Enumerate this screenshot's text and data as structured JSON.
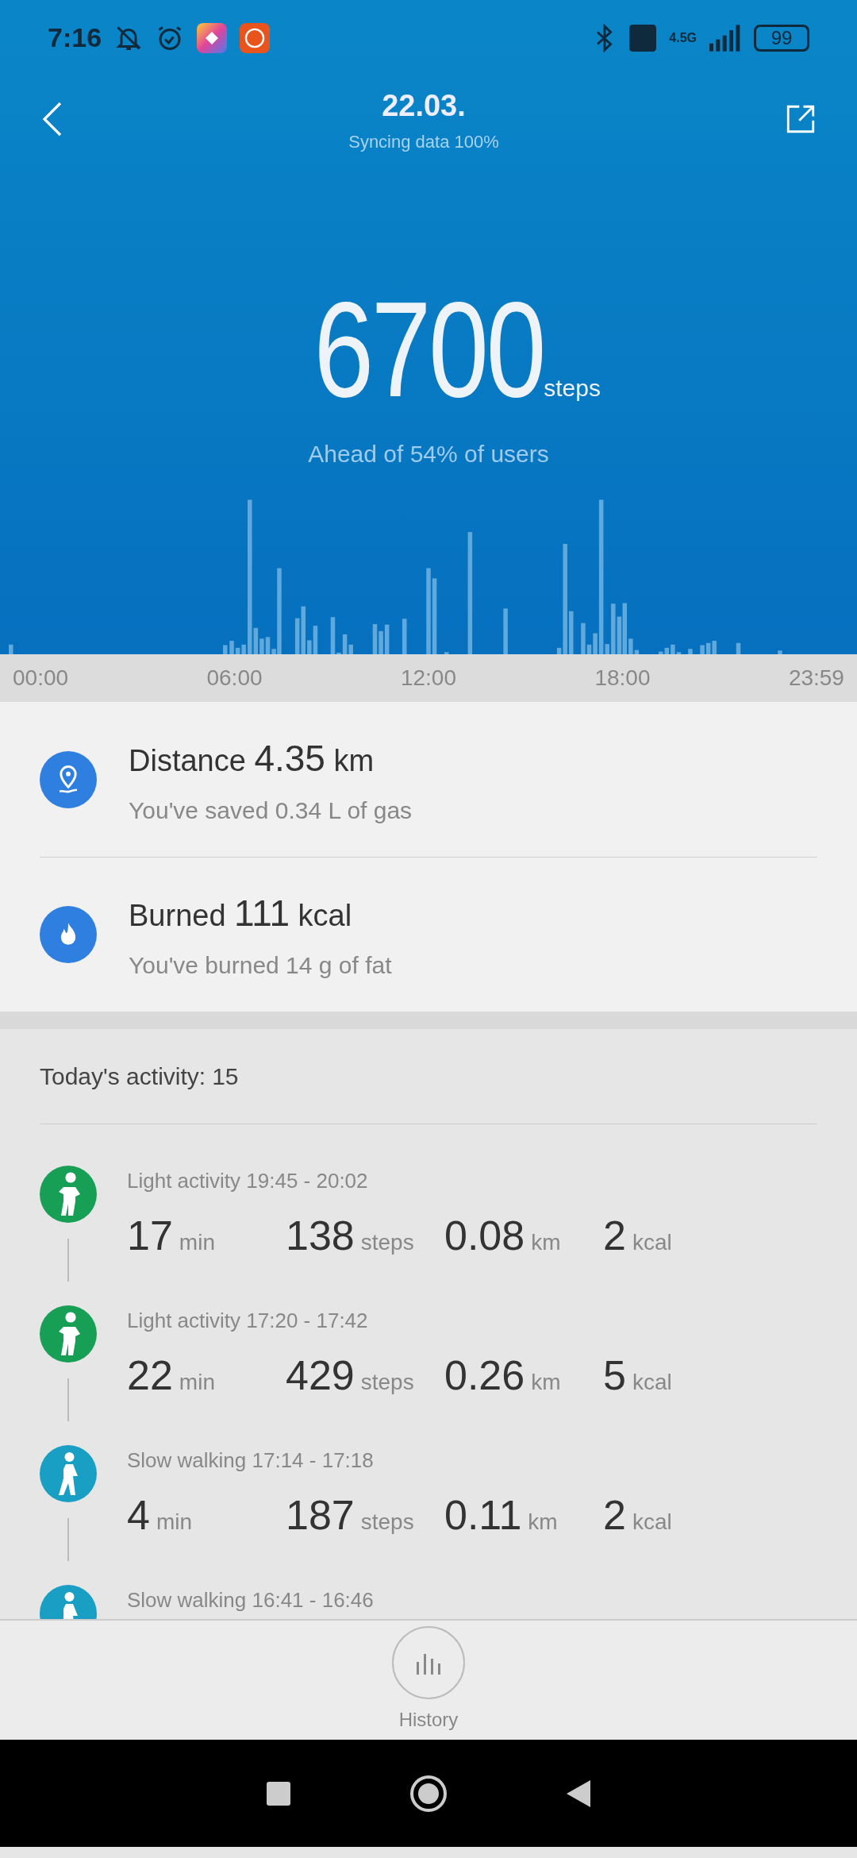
{
  "status_bar": {
    "time": "7:16",
    "network": "4.5G",
    "battery": "99"
  },
  "header": {
    "title": "22.03.",
    "subtitle": "Syncing data 100%"
  },
  "summary": {
    "steps": "6700",
    "unit": "steps",
    "ranking": "Ahead of 54% of users"
  },
  "axis_labels": [
    "00:00",
    "06:00",
    "12:00",
    "18:00",
    "23:59"
  ],
  "stats": [
    {
      "kind": "distance",
      "label": "Distance",
      "value": "4.35",
      "unit": "km",
      "note": "You've saved 0.34 L of gas"
    },
    {
      "kind": "burned",
      "label": "Burned",
      "value": "111",
      "unit": "kcal",
      "note": "You've burned 14 g of fat"
    }
  ],
  "activity": {
    "label": "Today's activity:",
    "count": "15",
    "items": [
      {
        "kind": "light",
        "title": "Light activity 19:45 - 20:02",
        "metrics": [
          {
            "value": "17",
            "unit": "min"
          },
          {
            "value": "138",
            "unit": "steps"
          },
          {
            "value": "0.08",
            "unit": "km"
          },
          {
            "value": "2",
            "unit": "kcal"
          }
        ]
      },
      {
        "kind": "light",
        "title": "Light activity 17:20 - 17:42",
        "metrics": [
          {
            "value": "22",
            "unit": "min"
          },
          {
            "value": "429",
            "unit": "steps"
          },
          {
            "value": "0.26",
            "unit": "km"
          },
          {
            "value": "5",
            "unit": "kcal"
          }
        ]
      },
      {
        "kind": "walk",
        "title": "Slow walking 17:14 - 17:18",
        "metrics": [
          {
            "value": "4",
            "unit": "min"
          },
          {
            "value": "187",
            "unit": "steps"
          },
          {
            "value": "0.11",
            "unit": "km"
          },
          {
            "value": "2",
            "unit": "kcal"
          }
        ]
      },
      {
        "kind": "walk",
        "title": "Slow walking 16:41 - 16:46"
      }
    ]
  },
  "bottom": {
    "history": "History"
  }
}
